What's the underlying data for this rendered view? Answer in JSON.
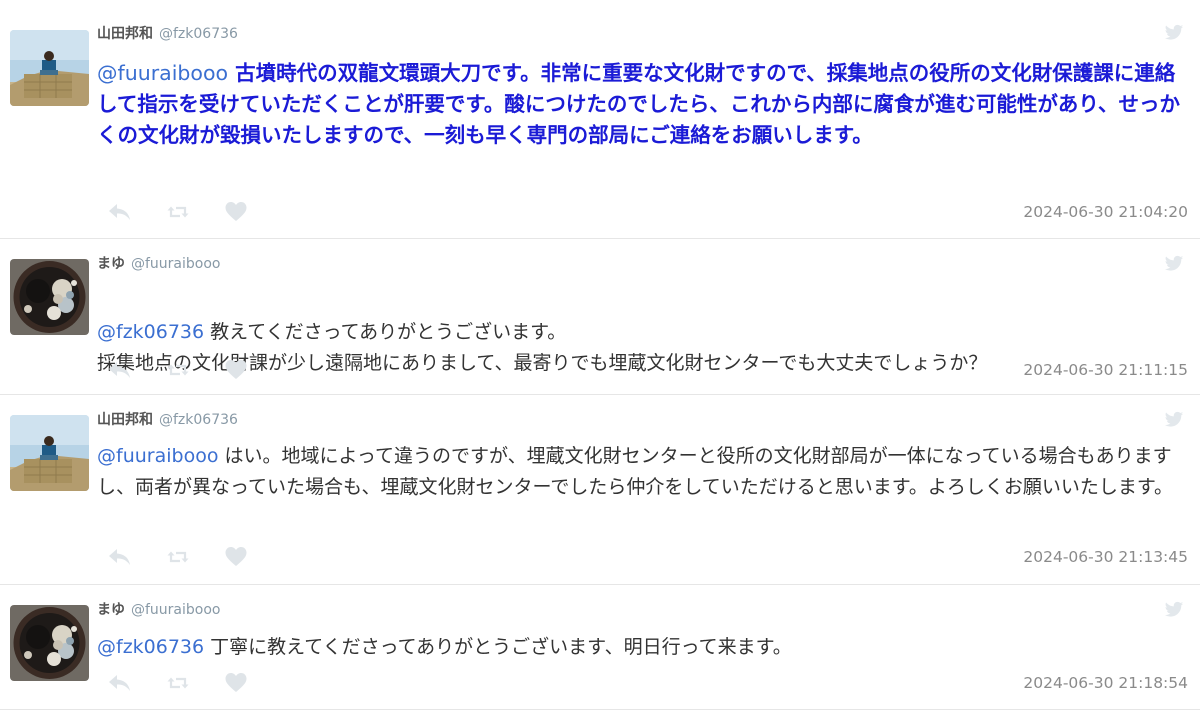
{
  "tweets": [
    {
      "name": "山田邦和",
      "handle": "@fzk06736",
      "mention": "@fuuraibooo",
      "text": " 古墳時代の双龍文環頭大刀です。非常に重要な文化財ですので、採集地点の役所の文化財保護課に連絡して指示を受けていただくことが肝要です。酸につけたのでしたら、これから内部に腐食が進む可能性があり、せっかくの文化財が毀損いたしますので、一刻も早く専門の部局にご連絡をお願いします。",
      "timestamp": "2024-06-30 21:04:20",
      "avatar": "pyramid-avatar"
    },
    {
      "name": "まゆ",
      "handle": "@fuuraibooo",
      "mention": "@fzk06736",
      "text": " 教えてくださってありがとうございます。\n採集地点の文化財課が少し遠隔地にありまして、最寄りでも埋蔵文化財センターでも大丈夫でしょうか？",
      "timestamp": "2024-06-30 21:11:15",
      "avatar": "mirror-avatar"
    },
    {
      "name": "山田邦和",
      "handle": "@fzk06736",
      "mention": "@fuuraibooo",
      "text": " はい。地域によって違うのですが、埋蔵文化財センターと役所の文化財部局が一体になっている場合もありますし、両者が異なっていた場合も、埋蔵文化財センターでしたら仲介をしていただけると思います。よろしくお願いいたします。",
      "timestamp": "2024-06-30 21:13:45",
      "avatar": "pyramid-avatar"
    },
    {
      "name": "まゆ",
      "handle": "@fuuraibooo",
      "mention": "@fzk06736",
      "text": " 丁寧に教えてくださってありがとうございます、明日行って来ます。",
      "timestamp": "2024-06-30 21:18:54",
      "avatar": "mirror-avatar"
    }
  ],
  "icons": {
    "reply": "reply-icon",
    "retweet": "retweet-icon",
    "like": "heart-icon",
    "platform": "twitter-bird-icon"
  },
  "colors": {
    "mention": "#3b6fd1",
    "highlight_text": "#1b1bd6",
    "meta": "#8899a6",
    "icon": "#cfd6dc"
  }
}
